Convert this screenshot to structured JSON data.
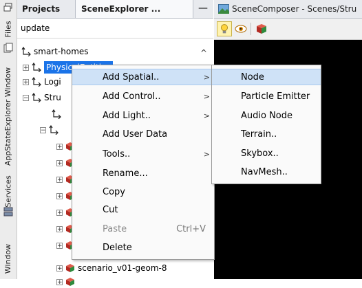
{
  "sidebar": {
    "tabs": [
      {
        "label": "Files"
      },
      {
        "label": "AppStateExplorer Window"
      },
      {
        "label": "Services"
      },
      {
        "label": "Window"
      }
    ]
  },
  "explorer": {
    "tabs": {
      "projects": "Projects",
      "scene": "SceneExplorer ...",
      "close_glyph": "×",
      "minimize_glyph": "—"
    },
    "update_label": "update",
    "tree": {
      "root": "smart-homes",
      "selected": "PhysicalEntities",
      "logic": "Logi",
      "structure": "Stru",
      "last_item": "scenario_v01-geom-8"
    }
  },
  "composer": {
    "title": "SceneComposer - Scenes/Stru",
    "background": "#000000"
  },
  "context_menu": {
    "items": [
      {
        "label": "Add Spatial..",
        "submenu": true,
        "highlighted": true
      },
      {
        "label": "Add Control..",
        "submenu": true
      },
      {
        "label": "Add Light..",
        "submenu": true
      },
      {
        "label": "Add User Data"
      },
      {
        "label": "Tools..",
        "submenu": true
      },
      {
        "label": "Rename..."
      },
      {
        "label": "Copy"
      },
      {
        "label": "Cut"
      },
      {
        "label": "Paste",
        "shortcut": "Ctrl+V",
        "disabled": true
      },
      {
        "label": "Delete"
      }
    ]
  },
  "submenu": {
    "items": [
      {
        "label": "Node",
        "highlighted": true
      },
      {
        "label": "Particle Emitter"
      },
      {
        "label": "Audio Node"
      },
      {
        "label": "Terrain.."
      },
      {
        "label": "Skybox.."
      },
      {
        "label": "NavMesh.."
      }
    ]
  },
  "colors": {
    "selection": "#1a73e8",
    "menu_highlight": "#cfe2f7",
    "cube_red": "#c0392b",
    "cube_green": "#2e8b3d"
  }
}
